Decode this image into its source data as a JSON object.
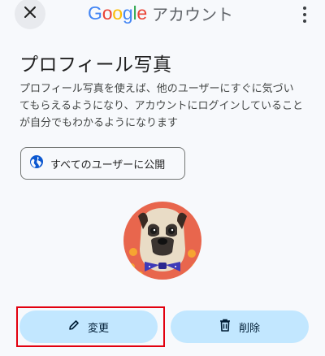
{
  "header": {
    "brand_google_letters": [
      {
        "ch": "G",
        "color": "#4285F4"
      },
      {
        "ch": "o",
        "color": "#EA4335"
      },
      {
        "ch": "o",
        "color": "#FBBC05"
      },
      {
        "ch": "g",
        "color": "#4285F4"
      },
      {
        "ch": "l",
        "color": "#34A853"
      },
      {
        "ch": "e",
        "color": "#EA4335"
      }
    ],
    "brand_google": "Google",
    "brand_account": "アカウント",
    "close_icon": "close-icon",
    "menu_icon": "more-vert-icon"
  },
  "main": {
    "title": "プロフィール写真",
    "description": "プロフィール写真を使えば、他のユーザーにすぐに気づいてもらえるようになり、アカウントにログインしていることが自分でもわかるようになります",
    "visibility_button": {
      "label": "すべてのユーザーに公開",
      "icon": "globe-icon"
    },
    "profile_photo": {
      "alt": "pug-with-bowtie"
    }
  },
  "actions": {
    "change": {
      "label": "変更",
      "icon": "pencil-icon"
    },
    "delete": {
      "label": "削除",
      "icon": "trash-icon"
    }
  },
  "colors": {
    "accent_button": "#c2e7ff",
    "highlight_border": "#e2000f",
    "globe": "#0b57d0"
  }
}
